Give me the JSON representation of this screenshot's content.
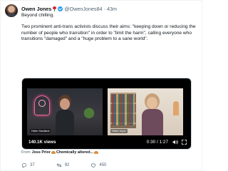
{
  "tweet": {
    "author_name": "Owen Jones",
    "author_handle": "@OwenJones84",
    "separator": "·",
    "time": "43m",
    "text_line1": "Beyond chilling.",
    "text_body": "Two prominent anti-trans activists discuss their aims: \"keeping down or reducing the number of people who transition\" in order to \"limit the harm\", calling everyone who transitions \"damaged\" and a \"huge problem to a sane world\".",
    "icons": {
      "author_emoji": "rose-icon",
      "verified": "verified-badge-icon"
    }
  },
  "video": {
    "views": "140.1K views",
    "duration": "0:30 / 1:27",
    "left_caption": "Helen Staniland",
    "right_caption": "Helen Joyce",
    "icons": {
      "speaker": "speaker-icon",
      "expand": "expand-icon"
    }
  },
  "attribution": {
    "prefix": "From",
    "author": "Joss Prior",
    "title": "Chemically altered...",
    "emoji": "croissant-icon"
  },
  "actions": {
    "reply_count": "37",
    "retweet_count": "92",
    "like_count": "450",
    "icons": {
      "reply": "reply-icon",
      "retweet": "retweet-icon",
      "like": "like-icon"
    }
  },
  "colors": {
    "brand_blue": "#1d9bf0",
    "muted": "#536471",
    "text": "#0f1419"
  }
}
